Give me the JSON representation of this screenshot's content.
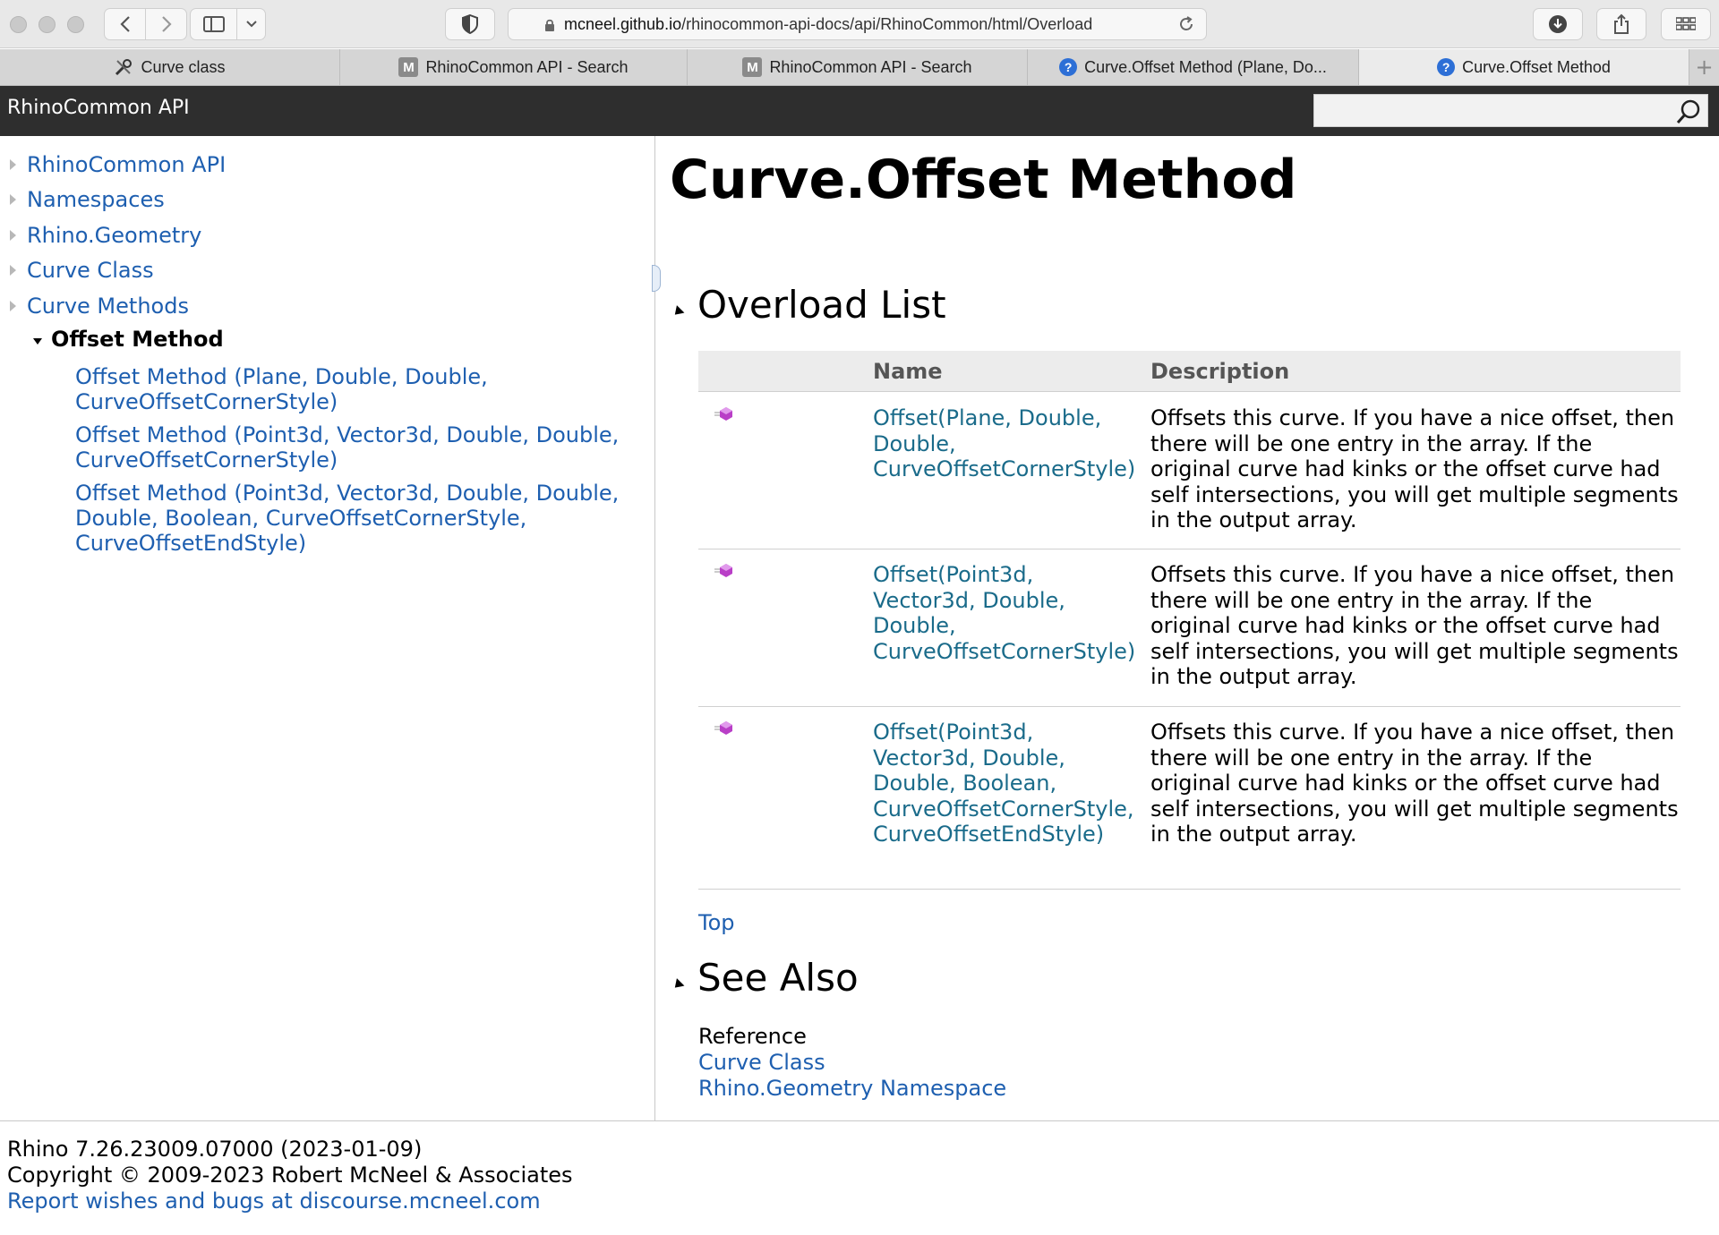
{
  "browser": {
    "address": {
      "host": "mcneel.github.io",
      "path": "/rhinocommon-api-docs/api/RhinoCommon/html/Overload"
    },
    "tabs": [
      {
        "label": "Curve class",
        "icon": "tools-icon"
      },
      {
        "label": "RhinoCommon API - Search",
        "icon": "m-icon"
      },
      {
        "label": "RhinoCommon API - Search",
        "icon": "m-icon"
      },
      {
        "label": "Curve.Offset Method (Plane, Do...",
        "icon": "help-icon"
      },
      {
        "label": "Curve.Offset Method",
        "icon": "help-icon",
        "active": true
      }
    ],
    "new_tab": "+"
  },
  "header": {
    "title": "RhinoCommon API",
    "search_value": ""
  },
  "sidebar": {
    "items": [
      {
        "label": "RhinoCommon API"
      },
      {
        "label": "Namespaces"
      },
      {
        "label": "Rhino.Geometry"
      },
      {
        "label": "Curve Class"
      },
      {
        "label": "Curve Methods"
      }
    ],
    "current": "Offset Method",
    "children": [
      {
        "label": "Offset Method (Plane, Double, Double, CurveOffsetCornerStyle)"
      },
      {
        "label": "Offset Method (Point3d, Vector3d, Double, Double, CurveOffsetCornerStyle)"
      },
      {
        "label": "Offset Method (Point3d, Vector3d, Double, Double, Double, Boolean, CurveOffsetCornerStyle, CurveOffsetEndStyle)"
      }
    ]
  },
  "main": {
    "title": "Curve.Offset Method",
    "overload_section": "Overload List",
    "table": {
      "headers": {
        "name": "Name",
        "description": "Description"
      },
      "rows": [
        {
          "name": "Offset(Plane, Double, Double, CurveOffsetCornerStyle)",
          "description": "Offsets this curve. If you have a nice offset, then there will be one entry in the array. If the original curve had kinks or the offset curve had self intersections, you will get multiple segments in the output array."
        },
        {
          "name": "Offset(Point3d, Vector3d, Double, Double, CurveOffsetCornerStyle)",
          "description": "Offsets this curve. If you have a nice offset, then there will be one entry in the array. If the original curve had kinks or the offset curve had self intersections, you will get multiple segments in the output array."
        },
        {
          "name": "Offset(Point3d, Vector3d, Double, Double, Boolean, CurveOffsetCornerStyle, CurveOffsetEndStyle)",
          "description": "Offsets this curve. If you have a nice offset, then there will be one entry in the array. If the original curve had kinks or the offset curve had self intersections, you will get multiple segments in the output array."
        }
      ]
    },
    "top_link": "Top",
    "see_also_section": "See Also",
    "reference_label": "Reference",
    "reference_links": [
      {
        "label": "Curve Class"
      },
      {
        "label": "Rhino.Geometry Namespace"
      }
    ]
  },
  "footer": {
    "version": "Rhino 7.26.23009.07000 (2023-01-09)",
    "copyright": "Copyright © 2009-2023 Robert McNeel & Associates",
    "report": "Report wishes and bugs at discourse.mcneel.com"
  },
  "colors": {
    "link": "#1e5fb0",
    "member_link": "#1a6b8a",
    "header_bg": "#2e2e2e"
  }
}
